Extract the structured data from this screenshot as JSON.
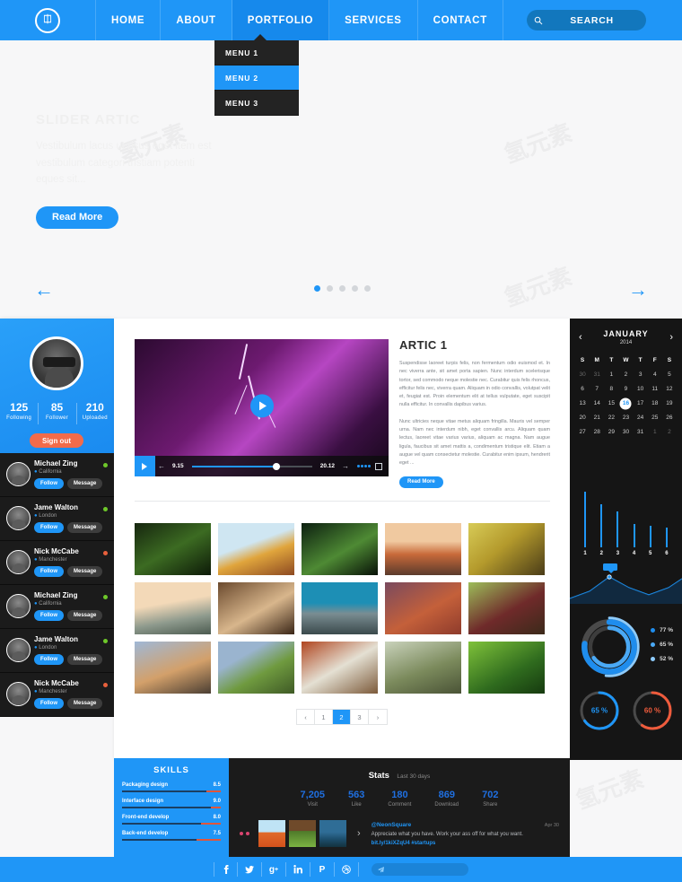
{
  "header": {
    "logo": "logo-icon",
    "nav": [
      {
        "label": "HOME",
        "active": false
      },
      {
        "label": "ABOUT",
        "active": false
      },
      {
        "label": "PORTFOLIO",
        "active": true
      },
      {
        "label": "SERVICES",
        "active": false
      },
      {
        "label": "CONTACT",
        "active": false
      }
    ],
    "search_label": "SEARCH"
  },
  "dropdown": {
    "items": [
      {
        "label": "MENU 1",
        "active": false
      },
      {
        "label": "MENU 2",
        "active": true
      },
      {
        "label": "MENU 3",
        "active": false
      }
    ]
  },
  "hero": {
    "title": "SLIDER ARTIC",
    "body": "Vestibulum lacus ut risus eget item est vestibulum categori tristiam potenti eques sit...",
    "button": "Read More",
    "prev_arrow": "←",
    "next_arrow": "→",
    "dots": [
      true,
      false,
      false,
      false,
      false
    ]
  },
  "profile": {
    "stats": [
      {
        "num": "125",
        "label": "Following"
      },
      {
        "num": "85",
        "label": "Follower"
      },
      {
        "num": "210",
        "label": "Uploaded"
      }
    ],
    "signout": "Sign out"
  },
  "contacts": {
    "follow_label": "Follow",
    "message_label": "Message",
    "items": [
      {
        "name": "Michael Zing",
        "location": "California",
        "status": "#6ec82a"
      },
      {
        "name": "Jame Walton",
        "location": "London",
        "status": "#6ec82a"
      },
      {
        "name": "Nick McCabe",
        "location": "Manchester",
        "status": "#e8603c"
      },
      {
        "name": "Michael Zing",
        "location": "California",
        "status": "#6ec82a"
      },
      {
        "name": "Jame Walton",
        "location": "London",
        "status": "#6ec82a"
      },
      {
        "name": "Nick McCabe",
        "location": "Manchester",
        "status": "#e8603c"
      }
    ]
  },
  "video": {
    "current_time": "9.15",
    "total_time": "20.12",
    "progress_pct": 70
  },
  "article": {
    "title": "ARTIC 1",
    "paragraph1": "Suspendisse laoreet turpis felis, non fermentum odio euismod et. In nec viverra ante, sit amet porta sapien. Nunc interdum scelerisque tortor, sed commodo neque molestie nec. Curabitur quis felis rhoncus, efficitur felis nec, viverra quam. Aliquam in odio convallis, volutpat velit et, feugiat est. Proin elementum elit at tellus vulputate, eget suscipit nulla efficitur. In convallis dapibus varius.",
    "paragraph2": "Nunc ultricies neque vitae metus aliquam fringilla. Mauris vel semper urna. Nam nec interdum nibh, eget convallis arcu. Aliquam quam lectus, laoreet vitae varius varius, aliquam ac magna. Nam augue ligula, faucibus sit amet mattis a, condimentum tristique elit. Etiam a augue vel quam consectetur molestie. Curabitur enim ipsum, hendrerit eget ...",
    "button": "Read More"
  },
  "gallery": {
    "thumbs": [
      "forest-trees",
      "hot-air-balloon",
      "green-plant",
      "golden-gate-bridge",
      "temple-roof",
      "mountain-valley",
      "still-life-book",
      "snowy-mountains",
      "autumn-leaves",
      "onion-pepper",
      "blossom-trees",
      "green-hills",
      "city-street",
      "forest-path",
      "leaf-dew"
    ]
  },
  "pagination": {
    "prev": "‹",
    "next": "›",
    "pages": [
      {
        "label": "1",
        "active": false
      },
      {
        "label": "2",
        "active": true
      },
      {
        "label": "3",
        "active": false
      }
    ]
  },
  "calendar": {
    "month": "JANUARY",
    "year": "2014",
    "prev": "‹",
    "next": "›",
    "dow": [
      "S",
      "M",
      "T",
      "W",
      "T",
      "F",
      "S"
    ],
    "days": [
      {
        "d": "30",
        "muted": true
      },
      {
        "d": "31",
        "muted": true
      },
      {
        "d": "1"
      },
      {
        "d": "2"
      },
      {
        "d": "3"
      },
      {
        "d": "4"
      },
      {
        "d": "5"
      },
      {
        "d": "6"
      },
      {
        "d": "7"
      },
      {
        "d": "8"
      },
      {
        "d": "9"
      },
      {
        "d": "10"
      },
      {
        "d": "11"
      },
      {
        "d": "12"
      },
      {
        "d": "13"
      },
      {
        "d": "14"
      },
      {
        "d": "15"
      },
      {
        "d": "16",
        "today": true
      },
      {
        "d": "17"
      },
      {
        "d": "18"
      },
      {
        "d": "19"
      },
      {
        "d": "20"
      },
      {
        "d": "21"
      },
      {
        "d": "22"
      },
      {
        "d": "23"
      },
      {
        "d": "24"
      },
      {
        "d": "25"
      },
      {
        "d": "26"
      },
      {
        "d": "27"
      },
      {
        "d": "28"
      },
      {
        "d": "29"
      },
      {
        "d": "30"
      },
      {
        "d": "31"
      },
      {
        "d": "1",
        "muted": true
      },
      {
        "d": "2",
        "muted": true
      }
    ]
  },
  "chart_data": [
    {
      "type": "bar",
      "title": "",
      "categories": [
        "1",
        "2",
        "3",
        "4",
        "5",
        "6"
      ],
      "values": [
        78,
        60,
        50,
        33,
        30,
        27
      ],
      "ylim": [
        0,
        90
      ],
      "xlabel": "",
      "ylabel": "",
      "color": "#1f96f7",
      "grid": true
    },
    {
      "type": "line",
      "title": "",
      "x": [
        0,
        1,
        2,
        3,
        4,
        5,
        6
      ],
      "values": [
        8,
        14,
        30,
        22,
        16,
        22,
        30
      ],
      "marker_index": 2,
      "marker_label": "",
      "color": "#1f96f7",
      "grid": false
    },
    {
      "type": "pie",
      "title": "",
      "labels": [
        "77 %",
        "65 %",
        "52 %"
      ],
      "values": [
        77,
        65,
        52
      ],
      "colors": [
        "#1f8ded",
        "#4aa9f5",
        "#8ecbfa"
      ],
      "legend_position": "right"
    },
    {
      "type": "pie",
      "title": "",
      "labels": [
        "65 %"
      ],
      "values": [
        65
      ],
      "colors": [
        "#1f96f7"
      ],
      "legend_position": "center"
    },
    {
      "type": "pie",
      "title": "",
      "labels": [
        "60 %"
      ],
      "values": [
        60
      ],
      "colors": [
        "#ef5b3c"
      ],
      "legend_position": "center"
    },
    {
      "type": "bar",
      "title": "SKILLS",
      "categories": [
        "Packaging design",
        "Interface design",
        "Front-end develop",
        "Back-end develop"
      ],
      "values": [
        8.5,
        9.0,
        8.0,
        7.5
      ],
      "ylim": [
        0,
        10
      ],
      "xlabel": "",
      "ylabel": "",
      "color": "#1b3f63"
    }
  ],
  "donut": {
    "legend": [
      {
        "label": "77 %",
        "color": "#1f8ded"
      },
      {
        "label": "65 %",
        "color": "#4aa9f5"
      },
      {
        "label": "52 %",
        "color": "#8ecbfa"
      }
    ]
  },
  "gauges": [
    {
      "value": "65 %",
      "color": "#1f96f7",
      "pct": 65
    },
    {
      "value": "60 %",
      "color": "#ef5b3c",
      "pct": 60
    }
  ],
  "skills": {
    "title": "SKILLS",
    "items": [
      {
        "name": "Packaging design",
        "value": "8.5",
        "pct": 85
      },
      {
        "name": "Interface design",
        "value": "9.0",
        "pct": 90
      },
      {
        "name": "Front-end develop",
        "value": "8.0",
        "pct": 80
      },
      {
        "name": "Back-end develop",
        "value": "7.5",
        "pct": 75
      }
    ]
  },
  "stats": {
    "title": "Stats",
    "subtitle": "Last 30 days",
    "items": [
      {
        "value": "7,205",
        "label": "Visit"
      },
      {
        "value": "563",
        "label": "Like"
      },
      {
        "value": "180",
        "label": "Comment"
      },
      {
        "value": "869",
        "label": "Download"
      },
      {
        "value": "702",
        "label": "Share"
      }
    ]
  },
  "tweet": {
    "user": "@NeonSquare",
    "date": "Apr 30",
    "text": "Appreciate what you have. Work your ass off for what you want.",
    "link": "bit.ly/1kiXZqU4 #startups",
    "next": "›"
  },
  "footer": {
    "socials": [
      "facebook-icon",
      "twitter-icon",
      "googleplus-icon",
      "linkedin-icon",
      "pinterest-icon",
      "dribbble-icon"
    ],
    "labels": [
      "f",
      "ᵛ",
      "g⁺",
      "in",
      "P",
      "●"
    ]
  },
  "colors": {
    "accent": "#1f96f7",
    "dark": "#1b1b1b",
    "orange": "#f26b4a",
    "red": "#ef5b3c"
  }
}
